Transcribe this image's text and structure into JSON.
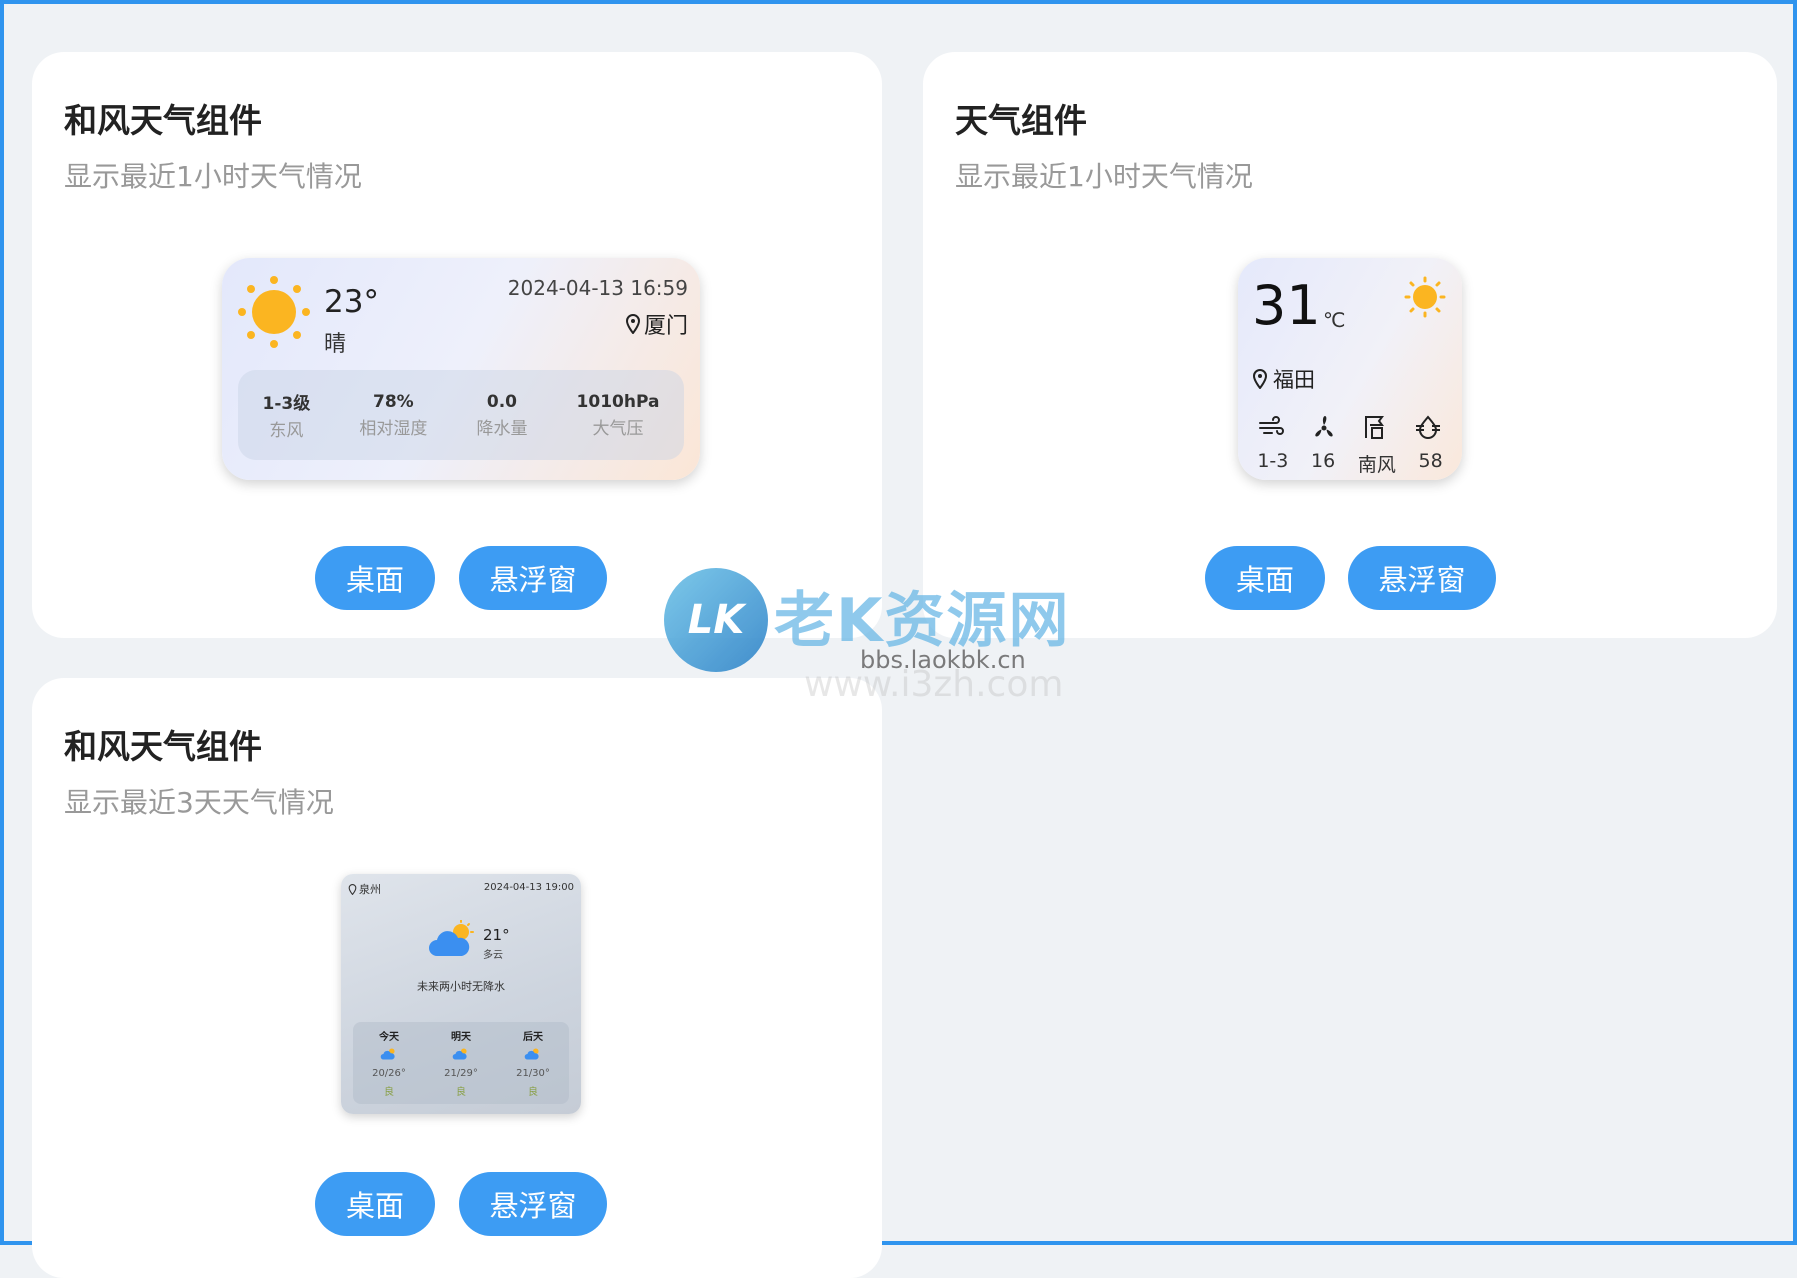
{
  "cards": [
    {
      "title": "和风天气组件",
      "subtitle": "显示最近1小时天气情况",
      "widget": {
        "temp": "23°",
        "condition": "晴",
        "datetime": "2024-04-13 16:59",
        "location": "厦门",
        "stats": [
          {
            "value": "1-3级",
            "label": "东风"
          },
          {
            "value": "78%",
            "label": "相对湿度"
          },
          {
            "value": "0.0",
            "label": "降水量"
          },
          {
            "value": "1010hPa",
            "label": "大气压"
          }
        ]
      },
      "btn_desktop": "桌面",
      "btn_float": "悬浮窗"
    },
    {
      "title": "天气组件",
      "subtitle": "显示最近1小时天气情况",
      "widget": {
        "temp": "31",
        "unit": "℃",
        "location": "福田",
        "stats": [
          "1-3",
          "16",
          "南风",
          "58"
        ]
      },
      "btn_desktop": "桌面",
      "btn_float": "悬浮窗"
    },
    {
      "title": "和风天气组件",
      "subtitle": "显示最近3天天气情况",
      "widget": {
        "location": "泉州",
        "datetime": "2024-04-13 19:00",
        "temp": "21°",
        "condition": "多云",
        "note": "未来两小时无降水",
        "forecast": [
          {
            "day": "今天",
            "range": "20/26°",
            "aqi": "良"
          },
          {
            "day": "明天",
            "range": "21/29°",
            "aqi": "良"
          },
          {
            "day": "后天",
            "range": "21/30°",
            "aqi": "良"
          }
        ]
      },
      "btn_desktop": "桌面",
      "btn_float": "悬浮窗"
    }
  ],
  "watermark": {
    "brand": "老K资源网",
    "logo": "LK",
    "url1": "bbs.laokbk.cn",
    "url2": "www.i3zh.com"
  },
  "colors": {
    "accent": "#3d9cf3",
    "sun": "#fbb521",
    "border": "#2f94ee"
  },
  "icons": [
    "sun-icon",
    "location-pin-icon",
    "wind-icon",
    "fan-icon",
    "wind-direction-icon",
    "humidity-icon",
    "cloud-sun-icon"
  ]
}
